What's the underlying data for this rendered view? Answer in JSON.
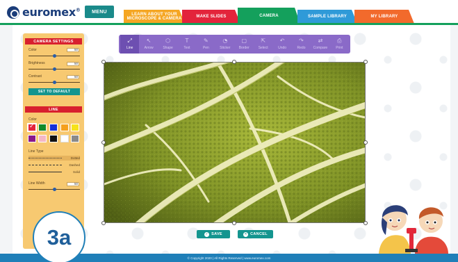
{
  "header": {
    "logo_text": "euromex",
    "logo_mark": "®",
    "menu_label": "MENU",
    "tabs": [
      {
        "line1": "LEARN ABOUT YOUR",
        "line2": "MICROSCOPE & CAMERA"
      },
      {
        "label": "MAKE SLIDES"
      },
      {
        "label": "CAMERA"
      },
      {
        "label": "SAMPLE LIBRARY"
      },
      {
        "label": "MY LIBRARY"
      }
    ],
    "active_tab": "CAMERA"
  },
  "camera_settings": {
    "title": "CAMERA SETTINGS",
    "controls": [
      {
        "label": "Color",
        "value": "50"
      },
      {
        "label": "Brightness",
        "value": "50"
      },
      {
        "label": "Contrast",
        "value": "50"
      }
    ],
    "default_button": "SET TO DEFAULT"
  },
  "line_panel": {
    "title": "LINE",
    "color_label": "Color",
    "colors": [
      "#e3243b",
      "#0f8a2a",
      "#1530d8",
      "#f5a01c",
      "#f6e21a",
      "#8a178c",
      "#f4b7c5",
      "#111111",
      "#ffffff",
      "#8a8a8a"
    ],
    "selected_color": "#e3243b",
    "line_type_label": "Line Type",
    "line_types": [
      "Dotted",
      "Dashed",
      "Solid"
    ],
    "selected_line_type": "Dotted",
    "line_width_label": "Line Width",
    "line_width_value": "50"
  },
  "toolbar": {
    "tools": [
      {
        "label": "Line",
        "icon": "line-icon",
        "glyph": "⤢"
      },
      {
        "label": "Arrow",
        "icon": "arrow-icon",
        "glyph": "↖"
      },
      {
        "label": "Shape",
        "icon": "shape-icon",
        "glyph": "⬡"
      },
      {
        "label": "Text",
        "icon": "text-icon",
        "glyph": "T"
      },
      {
        "label": "Pen",
        "icon": "pen-icon",
        "glyph": "✎"
      },
      {
        "label": "Sticker",
        "icon": "sticker-icon",
        "glyph": "◔"
      },
      {
        "label": "Border",
        "icon": "border-icon",
        "glyph": "▢"
      },
      {
        "label": "Select",
        "icon": "select-icon",
        "glyph": "⇱"
      },
      {
        "label": "Undo",
        "icon": "undo-icon",
        "glyph": "↶"
      },
      {
        "label": "Redo",
        "icon": "redo-icon",
        "glyph": "↷"
      },
      {
        "label": "Compare",
        "icon": "compare-icon",
        "glyph": "⇄"
      },
      {
        "label": "Print",
        "icon": "print-icon",
        "glyph": "⎙"
      }
    ],
    "active_tool": "Line"
  },
  "actions": {
    "save_label": "SAVE",
    "cancel_label": "CANCEL"
  },
  "footer": {
    "text": "© Copyright 2020  |  All Rights Reserved  |  www.euromex.com"
  },
  "step_badge": "3a",
  "colors": {
    "menu": "#1a8a8a",
    "panel_bg": "#f7c971",
    "panel_header": "#d8202e",
    "toolbar": "#8a6ac8",
    "action_button": "#14958f",
    "footer": "#1f7fb8"
  }
}
